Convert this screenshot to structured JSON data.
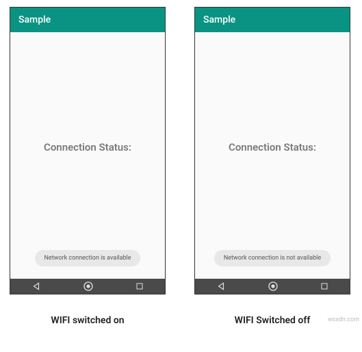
{
  "phones": [
    {
      "app_title": "Sample",
      "status_label": "Connection Status:",
      "toast": "Network connection is available",
      "caption": "WIFI switched on"
    },
    {
      "app_title": "Sample",
      "status_label": "Connection Status:",
      "toast": "Network connection is not available",
      "caption": "WIFI Switched off"
    }
  ],
  "watermark": "wsxdn.com"
}
